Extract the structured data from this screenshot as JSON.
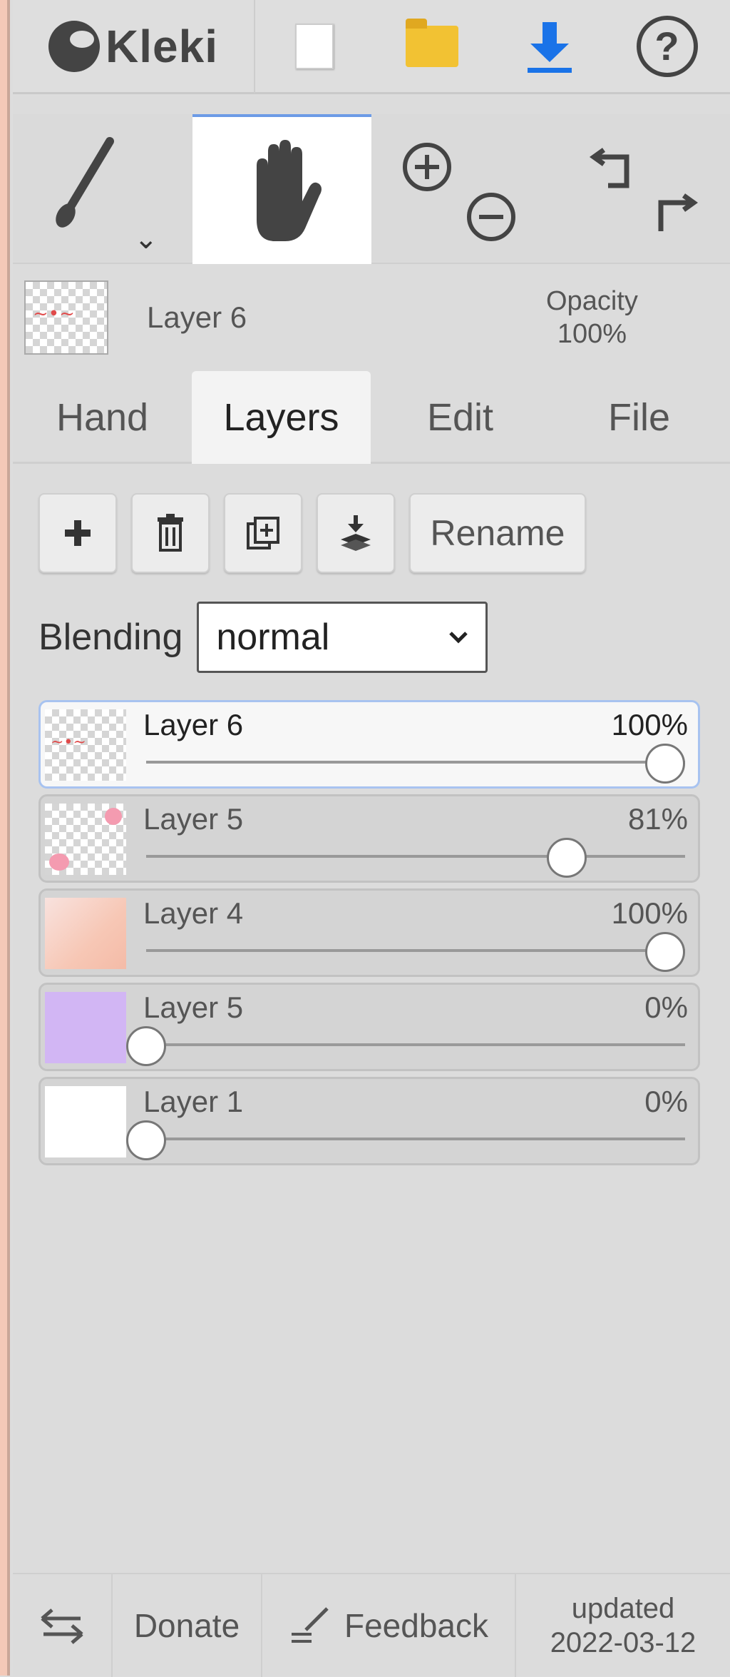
{
  "app": {
    "title": "Kleki"
  },
  "current_layer": {
    "name": "Layer 6",
    "opacity_label": "Opacity",
    "opacity_value": "100%"
  },
  "tabs": [
    "Hand",
    "Layers",
    "Edit",
    "File"
  ],
  "active_tab": "Layers",
  "layer_buttons": {
    "rename_label": "Rename"
  },
  "blending": {
    "label": "Blending",
    "value": "normal"
  },
  "layers": [
    {
      "name": "Layer 6",
      "opacity_text": "100%",
      "opacity": 100,
      "selected": true
    },
    {
      "name": "Layer 5",
      "opacity_text": "81%",
      "opacity": 81,
      "selected": false
    },
    {
      "name": "Layer 4",
      "opacity_text": "100%",
      "opacity": 100,
      "selected": false
    },
    {
      "name": "Layer 5",
      "opacity_text": "0%",
      "opacity": 0,
      "selected": false
    },
    {
      "name": "Layer 1",
      "opacity_text": "0%",
      "opacity": 0,
      "selected": false
    }
  ],
  "footer": {
    "donate": "Donate",
    "feedback": "Feedback",
    "updated_label": "updated",
    "updated_date": "2022-03-12"
  },
  "colors": {
    "accent": "#6c9be6",
    "download": "#1a73e8",
    "folder": "#f2c233"
  }
}
